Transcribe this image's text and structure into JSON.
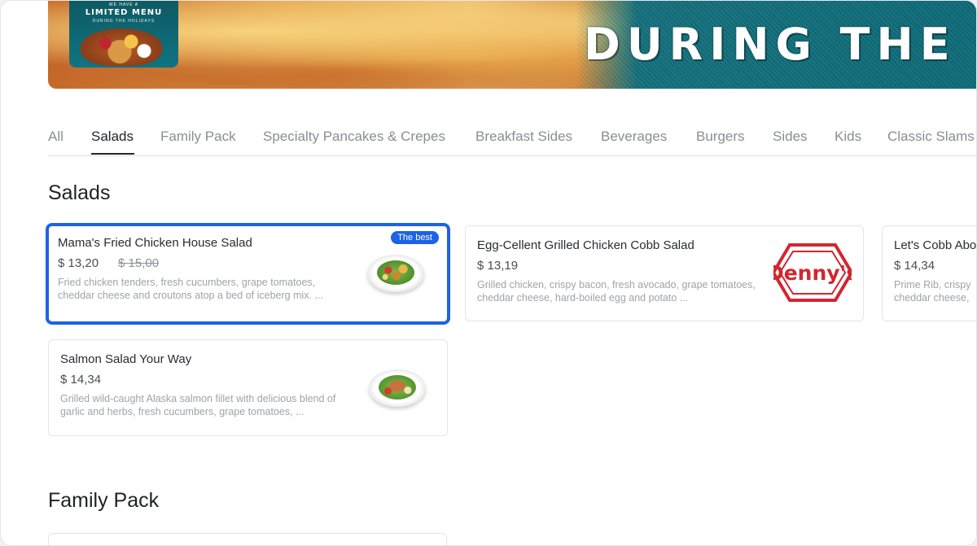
{
  "banner": {
    "headline": "DURING THE",
    "promo_top": "WE HAVE A",
    "promo_title": "LIMITED MENU",
    "promo_sub": "DURING THE HOLIDAYS"
  },
  "tabs": [
    {
      "label": "All"
    },
    {
      "label": "Salads"
    },
    {
      "label": "Family Pack"
    },
    {
      "label": "Specialty Pancakes & Crepes"
    },
    {
      "label": "Breakfast Sides"
    },
    {
      "label": "Beverages"
    },
    {
      "label": "Burgers"
    },
    {
      "label": "Sides"
    },
    {
      "label": "Kids"
    },
    {
      "label": "Classic Slams"
    }
  ],
  "active_tab": "Salads",
  "sections": {
    "salads_title": "Salads",
    "family_pack_title": "Family Pack"
  },
  "items": [
    {
      "name": "Mama's Fried Chicken House Salad",
      "price": "$ 13,20",
      "old_price": "$ 15,00",
      "badge": "The best",
      "description": "Fried chicken tenders, fresh cucumbers, grape tomatoes, cheddar cheese and croutons atop a bed of iceberg mix. ..."
    },
    {
      "name": "Egg-Cellent Grilled Chicken Cobb Salad",
      "price": "$ 13,19",
      "description": "Grilled chicken, crispy bacon, fresh avocado, grape tomatoes, cheddar cheese, hard-boiled egg and potato ...",
      "logo_text": "Denny's"
    },
    {
      "name": "Let's Cobb Abo",
      "price": "$ 14,34",
      "description": "Prime Rib, crispy cheddar cheese, "
    },
    {
      "name": "Salmon Salad Your Way",
      "price": "$ 14,34",
      "description": "Grilled wild-caught Alaska salmon fillet with delicious blend of garlic and herbs, fresh cucumbers, grape tomatoes, ..."
    }
  ],
  "colors": {
    "accent": "#1c63e6",
    "brand_red": "#d22630"
  }
}
